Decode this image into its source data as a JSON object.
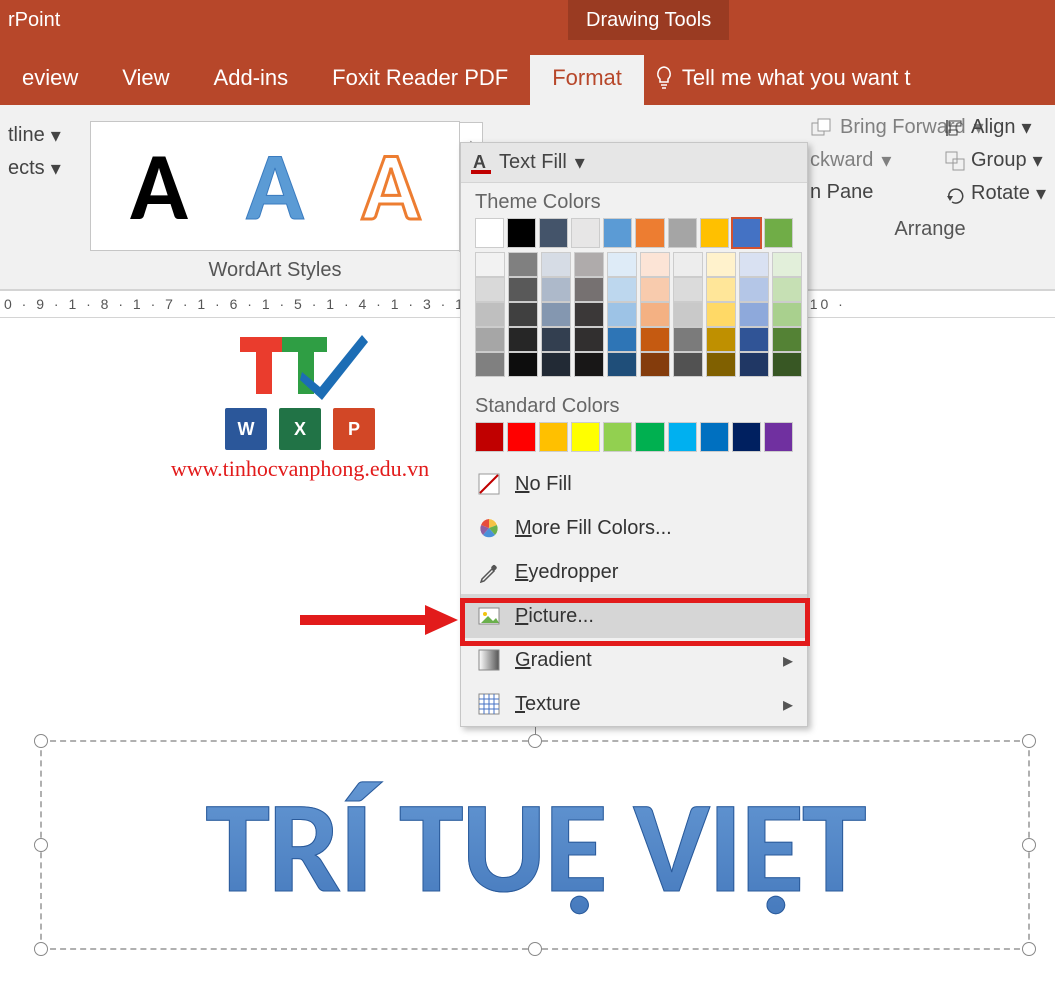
{
  "titlebar": {
    "app": "rPoint",
    "tools": "Drawing Tools"
  },
  "tabs": {
    "items": [
      "eview",
      "View",
      "Add-ins",
      "Foxit Reader PDF",
      "Format"
    ],
    "active_index": 4,
    "tell_me": "Tell me what you want t"
  },
  "ribbon": {
    "left_items": [
      "tline",
      "ects"
    ],
    "wordart_label": "WordArt Styles",
    "arrange": {
      "bring_forward": "Bring Forward",
      "backward": "ckward",
      "pane": "n Pane",
      "label": "Arrange"
    },
    "align": {
      "align": "Align",
      "group": "Group",
      "rotate": "Rotate"
    }
  },
  "ruler": "0 · 9 · 1 · 8 · 1 · 7 · 1 · 6 · 1 · 5 · 1 · 4 · 1 · 3 · 1 · 2 ·                                                                        1 · 6 · 1 · 7 · 1 · 8 · 1 · 9 · 1 · 10 ·",
  "dropdown": {
    "title": "Text Fill",
    "theme_label": "Theme Colors",
    "standard_label": "Standard Colors",
    "theme_colors": [
      "#FFFFFF",
      "#000000",
      "#44546A",
      "#E7E6E6",
      "#5B9BD5",
      "#ED7D31",
      "#A5A5A5",
      "#FFC000",
      "#4472C4",
      "#70AD47"
    ],
    "selected_theme_index": 8,
    "theme_shades": [
      [
        "#F2F2F2",
        "#D9D9D9",
        "#BFBFBF",
        "#A6A6A6",
        "#808080"
      ],
      [
        "#808080",
        "#595959",
        "#404040",
        "#262626",
        "#0D0D0D"
      ],
      [
        "#D6DCE5",
        "#ADB9CA",
        "#8497B0",
        "#333F50",
        "#222A35"
      ],
      [
        "#AFABAB",
        "#767171",
        "#3B3838",
        "#312F2F",
        "#181717"
      ],
      [
        "#DEEBF7",
        "#BDD7EE",
        "#9DC3E6",
        "#2E75B6",
        "#1F4E79"
      ],
      [
        "#FCE4D6",
        "#F8CBAD",
        "#F4B183",
        "#C55A11",
        "#843C0C"
      ],
      [
        "#EDEDED",
        "#DBDBDB",
        "#C9C9C9",
        "#7B7B7B",
        "#525252"
      ],
      [
        "#FFF2CC",
        "#FFE699",
        "#FFD966",
        "#BF9000",
        "#806000"
      ],
      [
        "#D9E1F2",
        "#B4C6E7",
        "#8EA9DB",
        "#305496",
        "#203764"
      ],
      [
        "#E2EFDA",
        "#C6E0B4",
        "#A9D08E",
        "#548235",
        "#385724"
      ]
    ],
    "standard_colors": [
      "#C00000",
      "#FF0000",
      "#FFC000",
      "#FFFF00",
      "#92D050",
      "#00B050",
      "#00B0F0",
      "#0070C0",
      "#002060",
      "#7030A0"
    ],
    "items": {
      "no_fill": "No Fill",
      "more": "More Fill Colors...",
      "eyedropper": "Eyedropper",
      "picture": "Picture...",
      "gradient": "Gradient",
      "texture": "Texture"
    }
  },
  "logo": {
    "url": "www.tinhocvanphong.edu.vn"
  },
  "wordart_text": "TRÍ TUỆ VIỆT"
}
